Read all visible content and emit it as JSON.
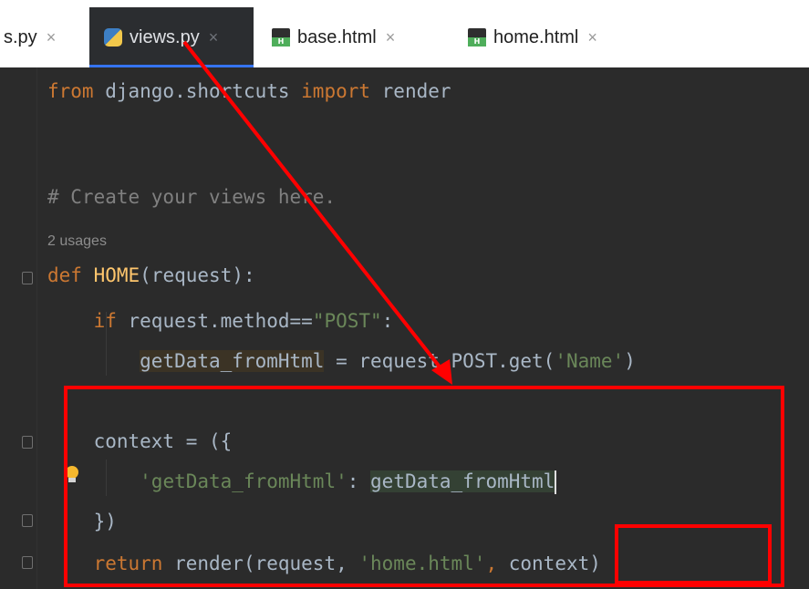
{
  "tabs": [
    {
      "label": "s.py",
      "icon": "python-file-icon"
    },
    {
      "label": "views.py",
      "icon": "python-file-icon",
      "active": true
    },
    {
      "label": "base.html",
      "icon": "html-file-icon"
    },
    {
      "label": "home.html",
      "icon": "html-file-icon"
    }
  ],
  "close_glyph": "×",
  "code": {
    "line1": {
      "kw": "from",
      "mod": " django.shortcuts ",
      "kw2": "import",
      "rest": " render"
    },
    "comment": "# Create your views here.",
    "usages": "2 usages",
    "def_line": {
      "kw": "def",
      "space": " ",
      "fn": "HOME",
      "rest": "(request):"
    },
    "if_line": {
      "indent": "    ",
      "kw": "if",
      "mid": " request.method==",
      "str": "\"POST\"",
      "end": ":"
    },
    "assign_line": {
      "indent": "        ",
      "var": "getData_fromHtml",
      "mid": " = request.POST.get(",
      "str": "'Name'",
      "end": ")"
    },
    "context_line": "    context = ({",
    "dict_line": {
      "indent": "        ",
      "key": "'getData_fromHtml'",
      "colon": ": ",
      "val": "getData_fromHtml"
    },
    "close_line": "    })",
    "return_line": {
      "indent": "    ",
      "kw": "return",
      "mid": " render(request, ",
      "str": "'home.html'",
      "comma": ",",
      "ctx": " context)"
    }
  },
  "colors": {
    "annotation_red": "#ff0000",
    "editor_bg": "#2b2b2b",
    "keyword": "#cc7832",
    "string": "#6a8759",
    "function": "#ffc66d"
  }
}
